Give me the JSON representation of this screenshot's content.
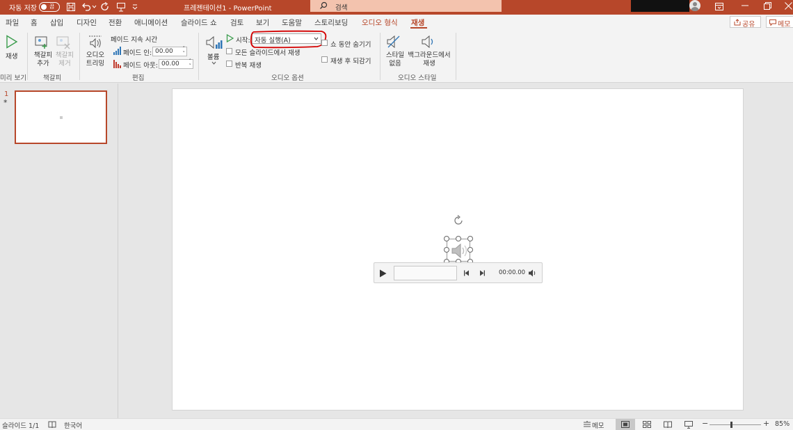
{
  "titlebar": {
    "autosave_label": "자동 저장",
    "autosave_state": "끔",
    "document_title": "프레젠테이션1 - PowerPoint",
    "search_placeholder": "검색"
  },
  "tabs": [
    "파일",
    "홈",
    "삽입",
    "디자인",
    "전환",
    "애니메이션",
    "슬라이드 쇼",
    "검토",
    "보기",
    "도움말",
    "스토리보딩",
    "오디오 형식",
    "재생"
  ],
  "active_tab": "재생",
  "share_label": "공유",
  "memo_label": "메모",
  "ribbon": {
    "preview": {
      "play_label": "재생",
      "group_label": "미리 보기"
    },
    "bookmarks": {
      "add_label": "책갈피 추가",
      "remove_label": "책갈피 제거",
      "group_label": "책갈피"
    },
    "editing": {
      "trim_label": "오디오 트리밍",
      "fade_duration_label": "페이드 지속 시간",
      "fade_in_label": "페이드 인:",
      "fade_in_value": "00.00",
      "fade_out_label": "페이드 아웃:",
      "fade_out_value": "00.00",
      "group_label": "편집"
    },
    "audio_options": {
      "volume_label": "볼륨",
      "start_label": "시작:",
      "start_value": "자동 실행(A)",
      "play_across_label": "모든 슬라이드에서 재생",
      "loop_label": "반복 재생",
      "hide_label": "쇼 동안 숨기기",
      "rewind_label": "재생 후 되감기",
      "group_label": "오디오 옵션"
    },
    "audio_styles": {
      "no_style_label": "스타일 없음",
      "background_label": "백그라운드에서 재생",
      "group_label": "오디오 스타일"
    }
  },
  "slides_panel": {
    "slide_number": "1",
    "animation_marker": "*"
  },
  "player": {
    "time": "00:00.00"
  },
  "status": {
    "slide_info": "슬라이드 1/1",
    "language": "한국어",
    "notes_label": "메모",
    "zoom": "85%"
  },
  "colors": {
    "accent": "#b7472a",
    "annotation": "#d40000"
  }
}
